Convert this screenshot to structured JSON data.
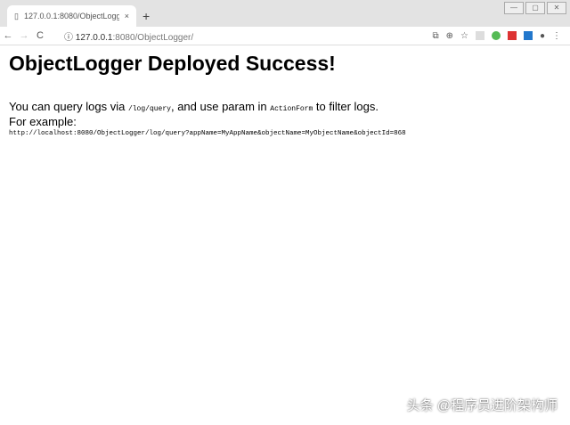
{
  "browser": {
    "tab_title": "127.0.0.1:8080/ObjectLogger/",
    "url_host": "127.0.0.1",
    "url_rest": ":8080/ObjectLogger/",
    "new_tab": "+",
    "close": "×",
    "back": "←",
    "forward": "→",
    "reload": "C",
    "info": "ⓘ",
    "translate": "⧉",
    "zoom": "⊕",
    "star": "☆",
    "menu": "⋮",
    "account": "●",
    "win_min": "—",
    "win_max": "▢",
    "win_close": "✕"
  },
  "page": {
    "title": "ObjectLogger Deployed Success!",
    "line1_a": "You can query logs via ",
    "line1_code": "/log/query",
    "line1_b": ", and use param in ",
    "line1_code2": "ActionForm",
    "line1_c": " to filter logs.",
    "line2": "For example:",
    "example_url": "http://localhost:8080/ObjectLogger/log/query?appName=MyAppName&objectName=MyObjectName&objectId=868"
  },
  "watermark": "头条 @程序员进阶架构师"
}
